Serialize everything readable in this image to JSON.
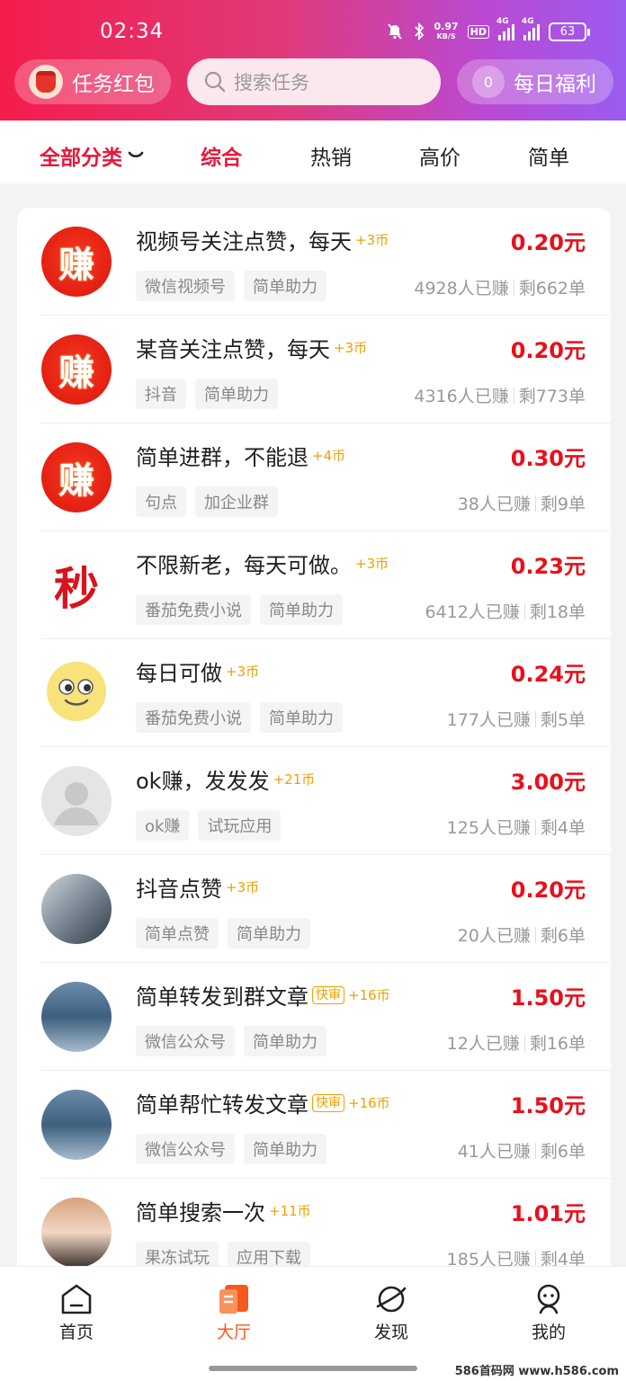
{
  "status_bar": {
    "time": "02:34",
    "speed_value": "0.97",
    "speed_unit": "KB/S",
    "hd": "HD",
    "sig1": "4G",
    "sig2": "4G",
    "battery": "63"
  },
  "header": {
    "hongbao_label": "任务红包",
    "search_placeholder": "搜索任务",
    "fuli_count": "0",
    "fuli_label": "每日福利"
  },
  "categories": {
    "all": "全部分类",
    "tabs": [
      "综合",
      "热销",
      "高价",
      "简单"
    ]
  },
  "tasks": [
    {
      "title": "视频号关注点赞，每天",
      "coins": "+3币",
      "fast": "",
      "price": "0.20元",
      "tags": [
        "微信视频号",
        "简单助力"
      ],
      "earned": "4928人已赚",
      "left": "剩662单",
      "avatar": "赚"
    },
    {
      "title": "某音关注点赞，每天",
      "coins": "+3币",
      "fast": "",
      "price": "0.20元",
      "tags": [
        "抖音",
        "简单助力"
      ],
      "earned": "4316人已赚",
      "left": "剩773单",
      "avatar": "赚"
    },
    {
      "title": "简单进群，不能退",
      "coins": "+4币",
      "fast": "",
      "price": "0.30元",
      "tags": [
        "句点",
        "加企业群"
      ],
      "earned": "38人已赚",
      "left": "剩9单",
      "avatar": "赚"
    },
    {
      "title": "不限新老，每天可做。",
      "coins": "+3币",
      "fast": "",
      "price": "0.23元",
      "tags": [
        "番茄免费小说",
        "简单助力"
      ],
      "earned": "6412人已赚",
      "left": "剩18单",
      "avatar": "秒"
    },
    {
      "title": "每日可做",
      "coins": "+3币",
      "fast": "",
      "price": "0.24元",
      "tags": [
        "番茄免费小说",
        "简单助力"
      ],
      "earned": "177人已赚",
      "left": "剩5单",
      "avatar": ""
    },
    {
      "title": "ok赚，发发发",
      "coins": "+21币",
      "fast": "",
      "price": "3.00元",
      "tags": [
        "ok赚",
        "试玩应用"
      ],
      "earned": "125人已赚",
      "left": "剩4单",
      "avatar": ""
    },
    {
      "title": "抖音点赞",
      "coins": "+3币",
      "fast": "",
      "price": "0.20元",
      "tags": [
        "简单点赞",
        "简单助力"
      ],
      "earned": "20人已赚",
      "left": "剩6单",
      "avatar": ""
    },
    {
      "title": "简单转发到群文章",
      "coins": "+16币",
      "fast": "快审",
      "price": "1.50元",
      "tags": [
        "微信公众号",
        "简单助力"
      ],
      "earned": "12人已赚",
      "left": "剩16单",
      "avatar": ""
    },
    {
      "title": "简单帮忙转发文章",
      "coins": "+16币",
      "fast": "快审",
      "price": "1.50元",
      "tags": [
        "微信公众号",
        "简单助力"
      ],
      "earned": "41人已赚",
      "left": "剩6单",
      "avatar": ""
    },
    {
      "title": "简单搜索一次",
      "coins": "+11币",
      "fast": "",
      "price": "1.01元",
      "tags": [
        "果冻试玩",
        "应用下载"
      ],
      "earned": "185人已赚",
      "left": "剩4单",
      "avatar": ""
    }
  ],
  "tabbar": [
    "首页",
    "大厅",
    "发现",
    "我的"
  ],
  "watermark": "586首码网 www.h586.com"
}
